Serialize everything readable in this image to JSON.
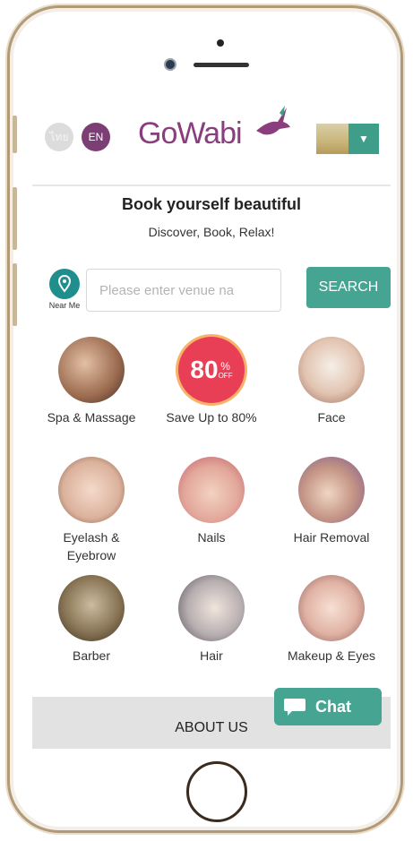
{
  "header": {
    "lang_thai": "ไทย",
    "lang_en": "EN",
    "logo": "GoWabi"
  },
  "hero": {
    "tagline": "Book yourself beautiful",
    "subtitle": "Discover, Book, Relax!"
  },
  "search": {
    "near_me_label": "Near Me",
    "placeholder": "Please enter venue na",
    "button_label": "SEARCH"
  },
  "categories": [
    {
      "label": "Spa & Massage",
      "icon": "spa-massage-image"
    },
    {
      "label": "Save Up to 80%",
      "icon": "discount-badge",
      "badge_number": "80",
      "badge_pct": "%",
      "badge_off": "OFF"
    },
    {
      "label": "Face",
      "icon": "face-image"
    },
    {
      "label": "Eyelash &",
      "label2": "Eyebrow",
      "icon": "eyelash-image"
    },
    {
      "label": "Nails",
      "icon": "nails-image"
    },
    {
      "label": "Hair Removal",
      "icon": "hair-removal-image"
    },
    {
      "label": "Barber",
      "icon": "barber-image"
    },
    {
      "label": "Hair",
      "icon": "hair-image"
    },
    {
      "label": "Makeup & Eyes",
      "icon": "makeup-image"
    }
  ],
  "footer": {
    "about_label": "ABOUT US",
    "chat_label": "Chat"
  },
  "colors": {
    "brand_purple": "#8a3e7e",
    "accent_teal": "#45a592",
    "badge_red": "#e83f57"
  }
}
